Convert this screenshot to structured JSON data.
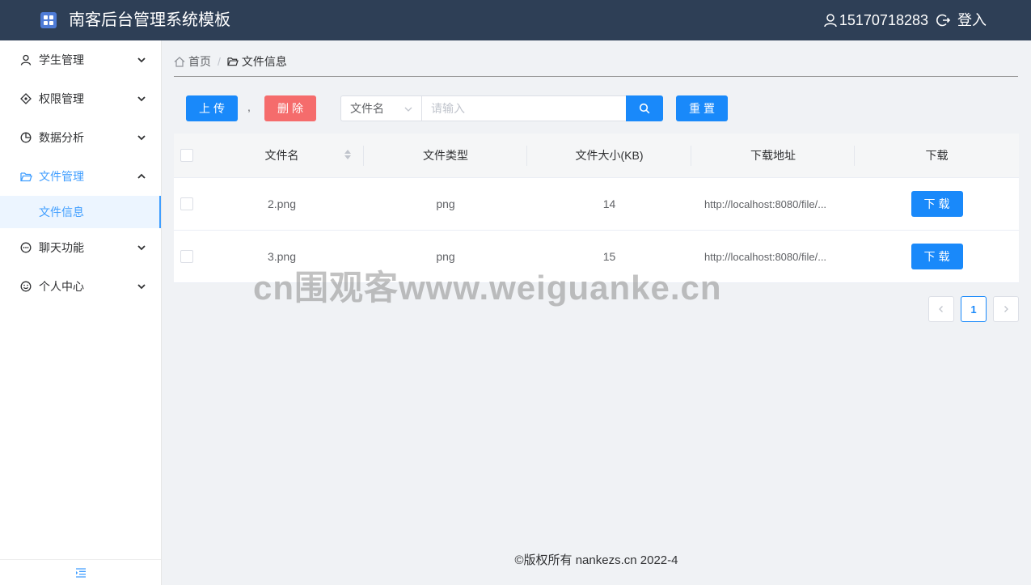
{
  "header": {
    "title": "南客后台管理系统模板",
    "username": "15170718283",
    "login_label": "登入"
  },
  "sidebar": {
    "items": [
      {
        "label": "学生管理",
        "icon": "user-icon"
      },
      {
        "label": "权限管理",
        "icon": "compass-icon"
      },
      {
        "label": "数据分析",
        "icon": "pie-chart-icon"
      },
      {
        "label": "文件管理",
        "icon": "folder-open-icon",
        "expanded": true
      },
      {
        "label": "聊天功能",
        "icon": "chat-bubble-icon"
      },
      {
        "label": "个人中心",
        "icon": "smile-icon"
      }
    ],
    "active_sub_item": "文件信息",
    "collapse_icon": "indent-icon"
  },
  "breadcrumb": {
    "home": "首页",
    "current": "文件信息"
  },
  "toolbar": {
    "upload_label": "上传",
    "separator": ",",
    "delete_label": "删除",
    "field_select_value": "文件名",
    "search_placeholder": "请输入",
    "reset_label": "重置"
  },
  "table": {
    "columns": [
      "文件名",
      "文件类型",
      "文件大小(KB)",
      "下载地址",
      "下载"
    ],
    "download_button_label": "下载",
    "rows": [
      {
        "name": "2.png",
        "type": "png",
        "size": "14",
        "url": "http://localhost:8080/file/..."
      },
      {
        "name": "3.png",
        "type": "png",
        "size": "15",
        "url": "http://localhost:8080/file/..."
      }
    ]
  },
  "pagination": {
    "current_page": "1"
  },
  "watermark": "cn围观客www.weiguanke.cn",
  "footer": "©版权所有 nankezs.cn 2022-4",
  "colors": {
    "header_bg": "#2e3f56",
    "primary": "#1989fa",
    "danger": "#f56c6c",
    "active_menu_bg": "#ecf5ff"
  }
}
